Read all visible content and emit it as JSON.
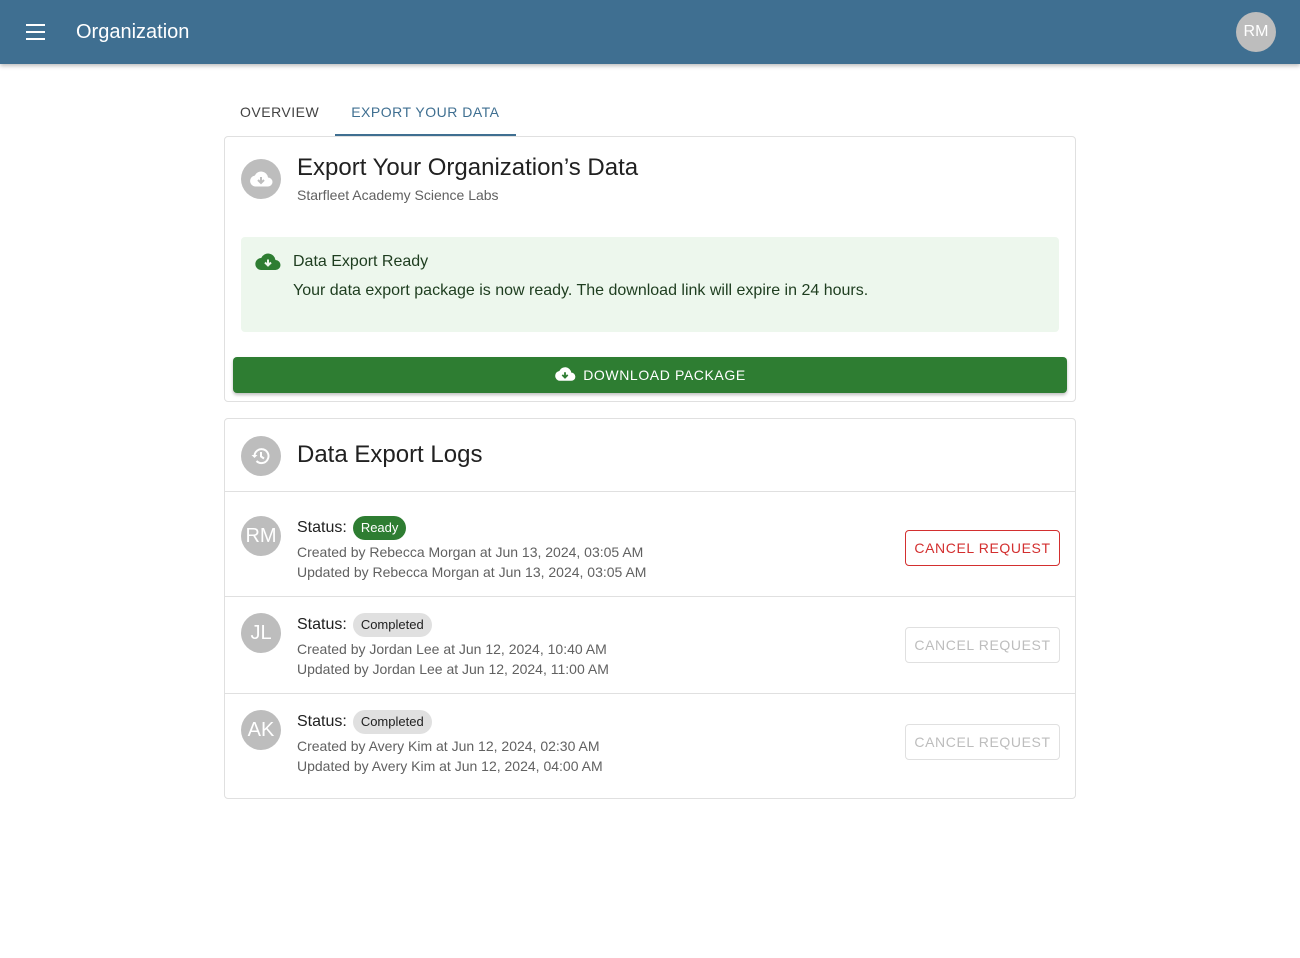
{
  "appbar": {
    "title": "Organization",
    "user_initials": "RM"
  },
  "tabs": [
    {
      "label": "OVERVIEW"
    },
    {
      "label": "EXPORT YOUR DATA"
    }
  ],
  "export_card": {
    "title": "Export Your Organization’s Data",
    "subtitle": "Starfleet Academy Science Labs",
    "alert": {
      "title": "Data Export Ready",
      "message": "Your data export package is now ready. The download link will expire in 24 hours."
    },
    "download_label": "DOWNLOAD PACKAGE"
  },
  "logs_card": {
    "title": "Data Export Logs",
    "status_label": "Status:",
    "entries": [
      {
        "initials": "RM",
        "status": "Ready",
        "created": "Created by Rebecca Morgan at Jun 13, 2024, 03:05 AM",
        "updated": "Updated by Rebecca Morgan at Jun 13, 2024, 03:05 AM",
        "action_label": "CANCEL REQUEST",
        "action_enabled": true
      },
      {
        "initials": "JL",
        "status": "Completed",
        "created": "Created by Jordan Lee at Jun 12, 2024, 10:40 AM",
        "updated": "Updated by Jordan Lee at Jun 12, 2024, 11:00 AM",
        "action_label": "CANCEL REQUEST",
        "action_enabled": false
      },
      {
        "initials": "AK",
        "status": "Completed",
        "created": "Created by Avery Kim at Jun 12, 2024, 02:30 AM",
        "updated": "Updated by Avery Kim at Jun 12, 2024, 04:00 AM",
        "action_label": "CANCEL REQUEST",
        "action_enabled": false
      }
    ]
  },
  "colors": {
    "appbar": "#3f6f91",
    "success": "#2e7d32",
    "alert_bg": "#edf7ed",
    "danger": "#d32f2f"
  }
}
